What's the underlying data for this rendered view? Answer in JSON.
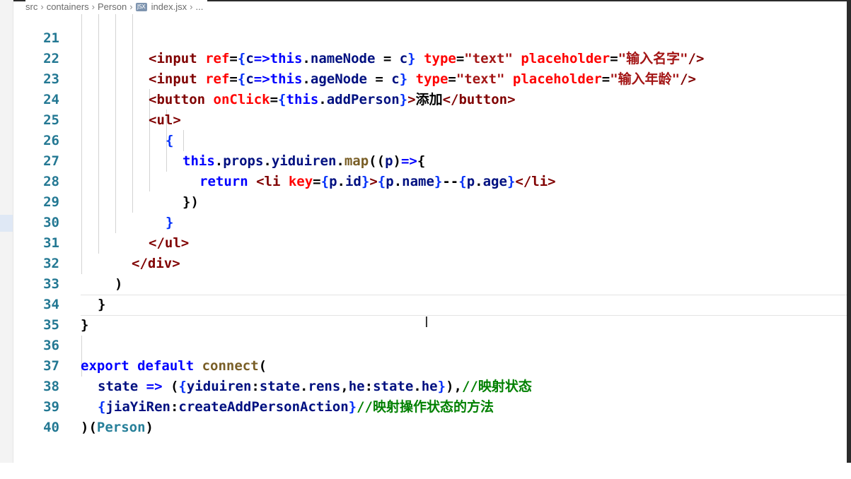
{
  "breadcrumb": {
    "items": [
      "src",
      "containers",
      "Person",
      "index.jsx",
      "..."
    ],
    "file_icon_text": "JSX"
  },
  "editor": {
    "lines": [
      {
        "num": "21",
        "text": "<input ref={c=>this.nameNode = c} type=\"text\" placeholder=\"输入名字\"/>"
      },
      {
        "num": "22",
        "text": "<input ref={c=>this.ageNode = c} type=\"text\" placeholder=\"输入年龄\"/>"
      },
      {
        "num": "23",
        "text": "<button onClick={this.addPerson}>添加</button>"
      },
      {
        "num": "24",
        "text": "<ul>"
      },
      {
        "num": "25",
        "text": "{"
      },
      {
        "num": "26",
        "text": "this.props.yiduiren.map((p)=>{"
      },
      {
        "num": "27",
        "text": "return <li key={p.id}>{p.name}--{p.age}</li>"
      },
      {
        "num": "28",
        "text": "})"
      },
      {
        "num": "29",
        "text": "}"
      },
      {
        "num": "30",
        "text": "</ul>"
      },
      {
        "num": "31",
        "text": "</div>"
      },
      {
        "num": "32",
        "text": ")"
      },
      {
        "num": "33",
        "text": "}"
      },
      {
        "num": "34",
        "text": "}"
      },
      {
        "num": "35",
        "text": ""
      },
      {
        "num": "36",
        "text": "export default connect("
      },
      {
        "num": "37",
        "text": "state => ({yiduiren:state.rens,he:state.he}),//映射状态"
      },
      {
        "num": "38",
        "text": "{jiaYiRen:createAddPersonAction}//映射操作状态的方法"
      },
      {
        "num": "39",
        "text": ")(Person)"
      },
      {
        "num": "40",
        "text": ""
      }
    ]
  },
  "colors": {
    "keyword": "#0000ff",
    "tag": "#800000",
    "attribute": "#ff0000",
    "string": "#a31515",
    "identifier": "#001080",
    "function": "#795e26",
    "comment": "#008000",
    "line_number": "#237893"
  },
  "icons": {
    "text_cursor": "I"
  }
}
